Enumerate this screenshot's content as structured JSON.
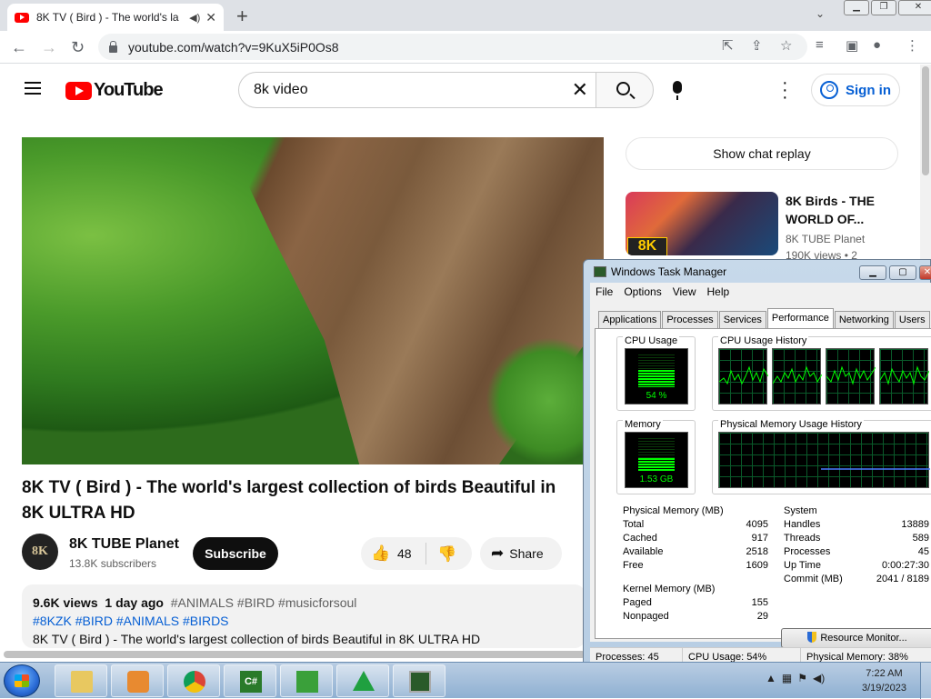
{
  "browser": {
    "tab_title": "8K TV ( Bird ) - The world's la",
    "url": "youtube.com/watch?v=9KuX5iP0Os8"
  },
  "youtube": {
    "logo_text": "YouTube",
    "search_query": "8k video",
    "signin_label": "Sign in",
    "video_title": "8K TV ( Bird ) - The world's largest collection of birds Beautiful in 8K ULTRA HD",
    "channel_name": "8K TUBE Planet",
    "subscribers": "13.8K subscribers",
    "avatar_text": "8K",
    "subscribe_label": "Subscribe",
    "like_count": "48",
    "share_label": "Share",
    "description": {
      "views": "9.6K views",
      "date": "1 day ago",
      "hashtags_line1": "#ANIMALS #BIRD #musicforsoul",
      "hashtags_line2": "#8KZK #BIRD #ANIMALS #BIRDS",
      "text": "8K TV ( Bird ) - The world's largest collection of birds Beautiful in 8K ULTRA HD"
    },
    "chat_replay_label": "Show chat replay",
    "recommended": {
      "title": "8K Birds - THE WORLD OF...",
      "channel": "8K TUBE Planet",
      "views": "190K views • 2",
      "badge": "8K"
    }
  },
  "task_manager": {
    "title": "Windows Task Manager",
    "menu": [
      "File",
      "Options",
      "View",
      "Help"
    ],
    "tabs": [
      "Applications",
      "Processes",
      "Services",
      "Performance",
      "Networking",
      "Users"
    ],
    "active_tab": "Performance",
    "cpu_usage_label": "CPU Usage",
    "cpu_usage_value": "54 %",
    "cpu_usage_fraction": 0.54,
    "cpu_history_label": "CPU Usage History",
    "memory_label": "Memory",
    "memory_value": "1.53 GB",
    "memory_fraction": 0.38,
    "phys_history_label": "Physical Memory Usage History",
    "physical_memory": {
      "header": "Physical Memory (MB)",
      "rows": [
        {
          "label": "Total",
          "value": "4095"
        },
        {
          "label": "Cached",
          "value": "917"
        },
        {
          "label": "Available",
          "value": "2518"
        },
        {
          "label": "Free",
          "value": "1609"
        }
      ]
    },
    "system": {
      "header": "System",
      "rows": [
        {
          "label": "Handles",
          "value": "13889"
        },
        {
          "label": "Threads",
          "value": "589"
        },
        {
          "label": "Processes",
          "value": "45"
        },
        {
          "label": "Up Time",
          "value": "0:00:27:30"
        },
        {
          "label": "Commit (MB)",
          "value": "2041 / 8189"
        }
      ]
    },
    "kernel_memory": {
      "header": "Kernel Memory (MB)",
      "rows": [
        {
          "label": "Paged",
          "value": "155"
        },
        {
          "label": "Nonpaged",
          "value": "29"
        }
      ]
    },
    "resource_monitor_label": "Resource Monitor...",
    "status": {
      "processes": "Processes: 45",
      "cpu": "CPU Usage: 54%",
      "memory": "Physical Memory: 38%"
    }
  },
  "taskbar": {
    "clock_time": "7:22 AM",
    "clock_date": "3/19/2023"
  }
}
